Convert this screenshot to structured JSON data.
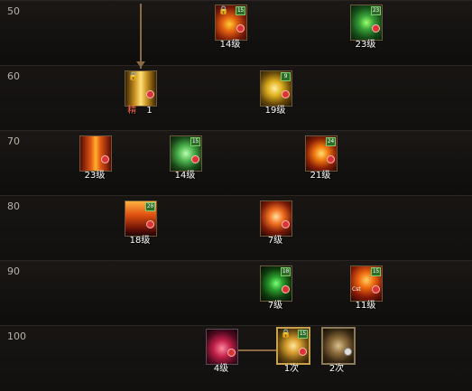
{
  "rows": [
    "50",
    "60",
    "70",
    "80",
    "90",
    "100"
  ],
  "skills": {
    "s50a": {
      "level": "14级",
      "badge": "15",
      "lock": "🔒"
    },
    "s50b": {
      "level": "23级",
      "badge": "23"
    },
    "s60a": {
      "level_red": "精",
      "level": "1",
      "badge": "",
      "lock": "🔒"
    },
    "s60b": {
      "level": "19级",
      "badge": "9"
    },
    "s70a": {
      "level": "23级"
    },
    "s70b": {
      "level": "14级",
      "badge": "15"
    },
    "s70c": {
      "level": "21级",
      "badge": "24"
    },
    "s80a": {
      "level": "18级",
      "badge": "20"
    },
    "s80b": {
      "level": "7级"
    },
    "s90a": {
      "level": "7级",
      "badge": "10"
    },
    "s90b": {
      "level": "11级",
      "badge": "15",
      "corner": "Cst"
    },
    "s100a": {
      "level": "4级"
    },
    "s100b": {
      "level": "1次",
      "badge": "15",
      "lock": "🔒"
    },
    "s100c": {
      "level": "2次"
    }
  }
}
